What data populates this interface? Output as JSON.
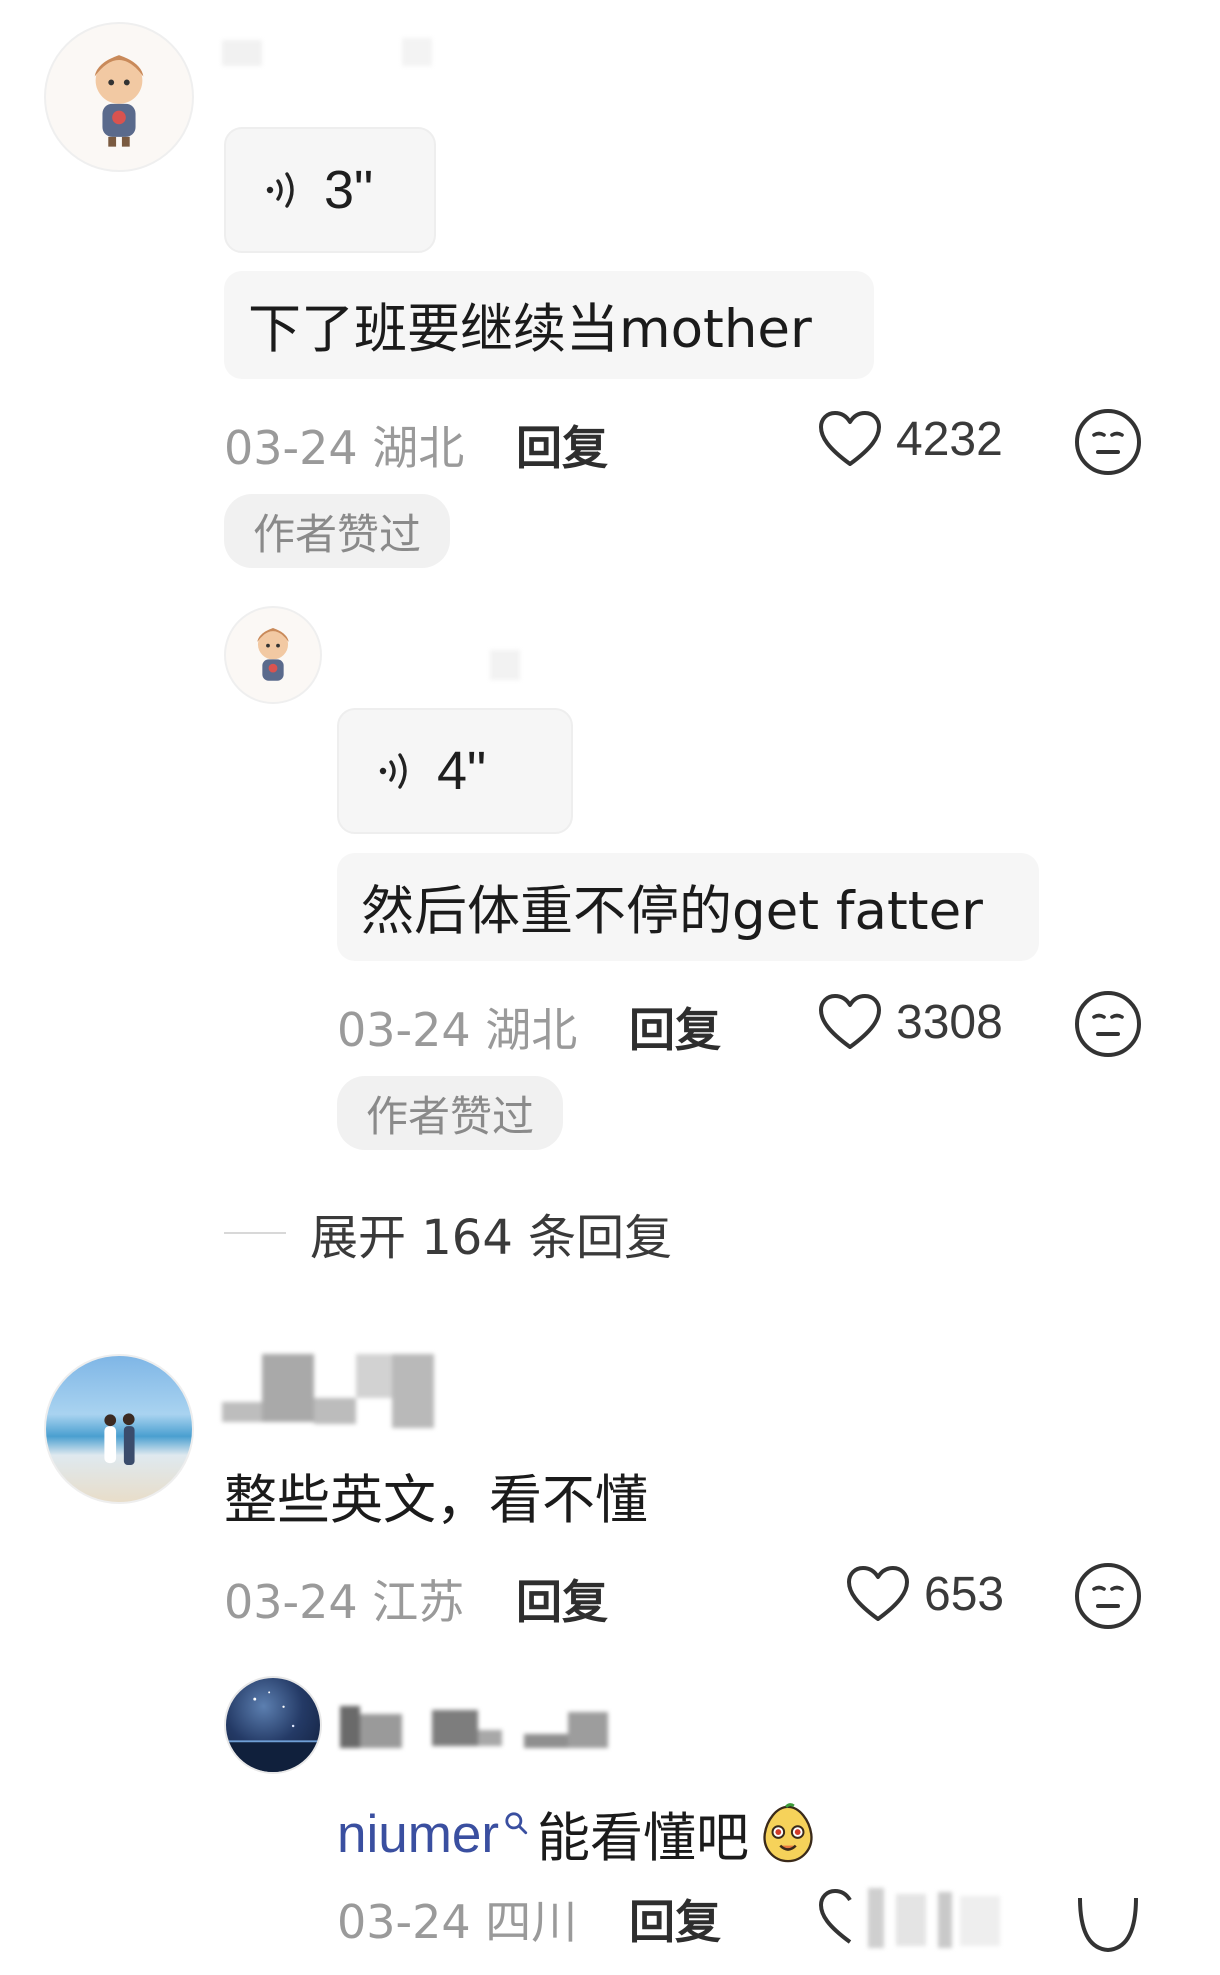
{
  "comments": [
    {
      "voice_duration": "3\"",
      "text": "下了班要继续当mother",
      "date": "03-24",
      "location": "湖北",
      "reply_label": "回复",
      "likes": "4232",
      "author_badge": "作者赞过",
      "replies": [
        {
          "voice_duration": "4\"",
          "text": "然后体重不停的get fatter",
          "date": "03-24",
          "location": "湖北",
          "reply_label": "回复",
          "likes": "3308",
          "author_badge": "作者赞过"
        }
      ],
      "expand_label": "展开 164 条回复"
    },
    {
      "text": "整些英文，看不懂",
      "date": "03-24",
      "location": "江苏",
      "reply_label": "回复",
      "likes": "653",
      "replies": [
        {
          "mention": "niumer",
          "text": "能看懂吧",
          "date": "03-24",
          "location": "四川",
          "reply_label": "回复"
        }
      ]
    }
  ],
  "colors": {
    "bubble_bg": "#f6f6f6",
    "meta_text": "#9a9a9a",
    "badge_bg": "#f1f1f1",
    "mention": "#3a4fa0"
  },
  "icons": {
    "voice": "voice-wave-icon",
    "like": "heart-outline-icon",
    "dislike": "neutral-face-icon",
    "search": "search-icon",
    "emoji": "potato-emoji-icon"
  }
}
